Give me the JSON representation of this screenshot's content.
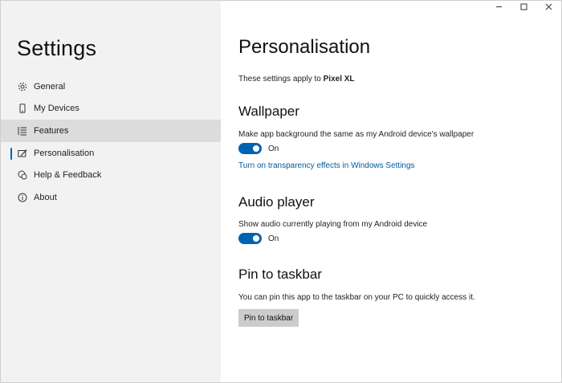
{
  "window": {
    "controls": [
      "minimize-icon",
      "maximize-icon",
      "close-icon"
    ]
  },
  "sidebar": {
    "title": "Settings",
    "items": [
      {
        "label": "General",
        "icon": "gear-icon"
      },
      {
        "label": "My Devices",
        "icon": "phone-icon"
      },
      {
        "label": "Features",
        "icon": "list-icon",
        "state": "hover"
      },
      {
        "label": "Personalisation",
        "icon": "paint-icon",
        "state": "selected"
      },
      {
        "label": "Help & Feedback",
        "icon": "chat-help-icon"
      },
      {
        "label": "About",
        "icon": "info-icon"
      }
    ]
  },
  "main": {
    "title": "Personalisation",
    "apply_prefix": "These settings apply to ",
    "device_name": "Pixel XL",
    "wallpaper": {
      "heading": "Wallpaper",
      "description": "Make app background the same as my Android device's wallpaper",
      "toggle_state": "On",
      "link": "Turn on transparency effects in Windows Settings"
    },
    "audio": {
      "heading": "Audio player",
      "description": "Show audio currently playing from my Android device",
      "toggle_state": "On"
    },
    "pin": {
      "heading": "Pin to taskbar",
      "description": "You can pin this app to the taskbar on your PC to quickly access it.",
      "button_label": "Pin to taskbar"
    }
  },
  "colors": {
    "accent": "#0063b1",
    "link": "#005a9e",
    "sidebar_bg": "#f2f2f2",
    "hover_bg": "#dcdcdc"
  }
}
